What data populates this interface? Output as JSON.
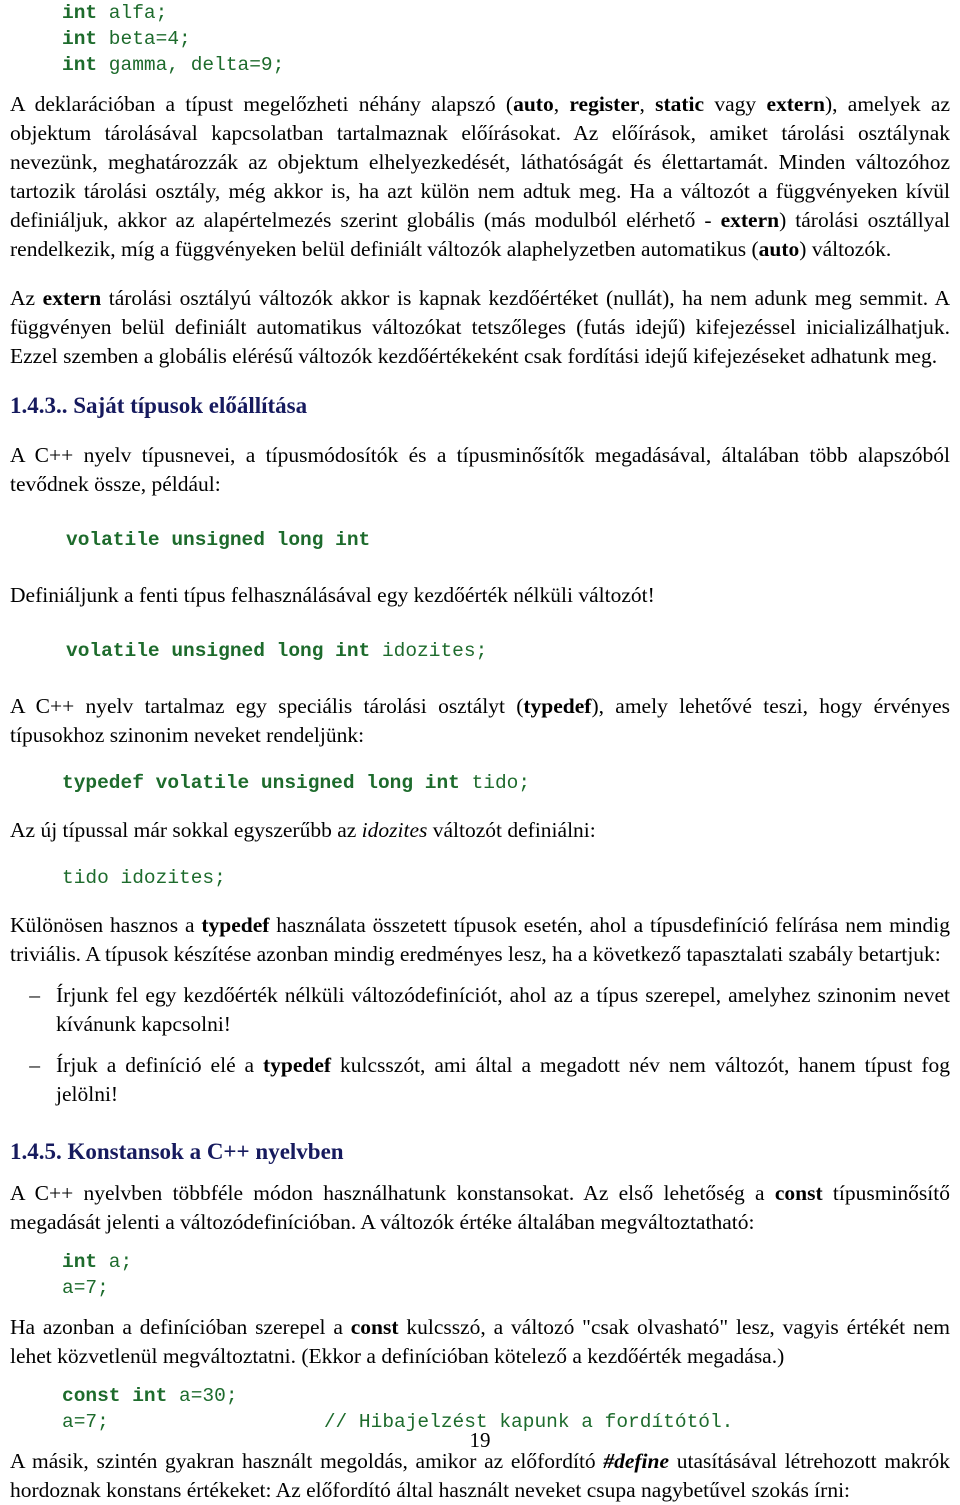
{
  "page": {
    "number": "19"
  },
  "colors": {
    "code_green": "#1d6b2c",
    "heading_navy": "#161a5e",
    "body_text": "#000000",
    "background": "#ffffff"
  },
  "code_block_1": {
    "line1_kw": "int",
    "line1_rest": " alfa;",
    "line2_kw": "int",
    "line2_rest": " beta=4;",
    "line3_kw": "int",
    "line3_rest": " gamma, delta=9;"
  },
  "paragraph_1": {
    "part1": "A deklarációban a típust megelőzheti néhány alapszó (",
    "kw_auto": "auto",
    "sep1": ", ",
    "kw_register": "register",
    "sep2": ", ",
    "kw_static": "static",
    "sep3": " vagy ",
    "kw_extern": "extern",
    "part2": "), amelyek az objektum tárolásával kapcsolatban tartalmaznak előírásokat. Az előírások, amiket tárolási osztálynak nevezünk, meghatározzák az objektum elhelyezkedését, láthatóságát és élettartamát. Minden változóhoz tartozik tárolási osztály, még akkor is, ha azt külön nem adtuk meg. Ha a változót a függvényeken kívül definiáljuk, akkor az alapértelmezés szerint globális (más modulból elérhető - ",
    "kw_extern2": "extern",
    "part3": ") tárolási osztállyal rendelkezik, míg a függvényeken belül definiált változók alaphelyzetben automatikus (",
    "kw_auto2": "auto",
    "part4": ") változók."
  },
  "paragraph_2": {
    "part1": "Az ",
    "kw_extern": "extern",
    "part2": " tárolási osztályú változók akkor is kapnak kezdőértéket (nullát), ha nem adunk meg semmit. A függvényen belül definiált automatikus változókat tetszőleges (futás idejű) kifejezéssel inicializálhatjuk. Ezzel szemben a globális elérésű változók kezdőértékeként csak fordítási idejű kifejezéseket adhatunk meg."
  },
  "heading_1": {
    "text": "1.4.3.. Saját típusok előállítása"
  },
  "paragraph_3": {
    "text": "A C++ nyelv típusnevei, a típusmódosítók és a típusminősítők megadásával, általában több alapszóból tevődnek össze, például:"
  },
  "code_block_2": {
    "bold": "volatile unsigned long int"
  },
  "paragraph_4": {
    "text": "Definiáljunk a fenti típus felhasználásával egy kezdőérték nélküli változót!"
  },
  "code_block_3": {
    "bold": "volatile unsigned long int",
    "plain": " idozites;"
  },
  "paragraph_5": {
    "part1": "A C++ nyelv tartalmaz egy speciális tárolási osztályt (",
    "kw_typedef": "typedef",
    "part2": "), amely lehetővé teszi, hogy érvényes típusokhoz szinonim neveket rendeljünk:"
  },
  "code_block_4": {
    "bold": "typedef volatile unsigned long int",
    "plain": " tido;"
  },
  "paragraph_6": {
    "part1": "Az új típussal már sokkal egyszerűbb az ",
    "italic": "idozites",
    "part2": " változót definiálni:"
  },
  "code_block_5": {
    "plain": "tido idozites;"
  },
  "paragraph_7": {
    "part1": "Különösen hasznos a ",
    "kw_typedef": "typedef",
    "part2": " használata összetett típusok esetén, ahol a típusdefiníció felírása nem mindig triviális. A típusok készítése azonban mindig eredményes lesz, ha a következő tapasztalati szabály betartjuk:"
  },
  "list_items": [
    {
      "dash": "–",
      "pre": "Írjunk fel egy kezdőérték nélküli változódefiníciót, ahol az a típus szerepel, amelyhez szinonim nevet kívánunk kapcsolni!",
      "bold": "",
      "post": ""
    },
    {
      "dash": "–",
      "pre": "Írjuk a definíció elé a ",
      "bold": "typedef",
      "post": " kulcsszót, ami által a megadott név nem változót, hanem típust fog jelölni!"
    }
  ],
  "heading_2": {
    "text": "1.4.5. Konstansok a C++ nyelvben"
  },
  "paragraph_8": {
    "part1": "A C++ nyelvben többféle módon használhatunk konstansokat. Az első lehetőség a ",
    "kw_const": "const",
    "part2": " típusminősítő megadását jelenti a változódefinícióban. A változók értéke általában megváltoztatható:"
  },
  "code_block_6": {
    "line1_kw": "int",
    "line1_rest": " a;",
    "line2": "a=7;"
  },
  "paragraph_9": {
    "part1": "Ha azonban a definícióban szerepel a ",
    "kw_const": "const",
    "part2": " kulcsszó, a változó \"csak olvasható\" lesz, vagyis értékét nem lehet közvetlenül megváltoztatni. (Ekkor a definícióban kötelező a kezdőérték megadása.)"
  },
  "code_block_7": {
    "line1_kw": "const int",
    "line1_rest": " a=30;",
    "line2": "a=7;",
    "line2_comment": "// Hibajelzést kapunk a fordítótól."
  },
  "paragraph_10": {
    "part1": "A másik, szintén gyakran használt megoldás, amikor az előfordító ",
    "bi_define": "#define",
    "part2": " utasításával létrehozott makrók hordoznak konstans értékeket: Az előfordító által használt neveket csupa nagybetűvel szokás írni:"
  }
}
